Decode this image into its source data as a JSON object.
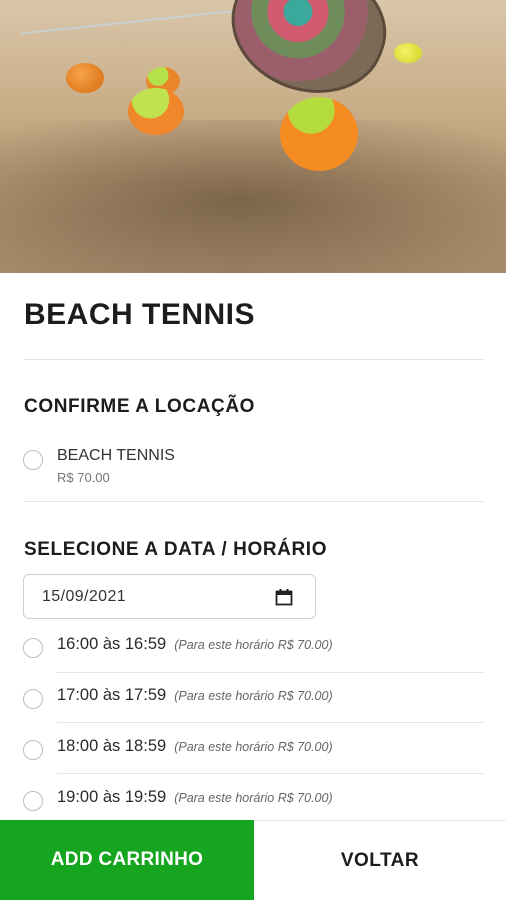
{
  "hero": {
    "image_alt": "beach tennis balls and racket on sand"
  },
  "product": {
    "title": "BEACH TENNIS"
  },
  "location_section": {
    "title": "CONFIRME A LOCAÇÃO",
    "option": {
      "label": "BEACH TENNIS",
      "price": "R$ 70.00"
    }
  },
  "schedule_section": {
    "title": "SELECIONE A DATA / HORÁRIO",
    "date_value": "15/09/2021",
    "slots": [
      {
        "time": "16:00 às 16:59",
        "note": "(Para este horário R$ 70.00)"
      },
      {
        "time": "17:00 às 17:59",
        "note": "(Para este horário R$ 70.00)"
      },
      {
        "time": "18:00 às 18:59",
        "note": "(Para este horário R$ 70.00)"
      },
      {
        "time": "19:00 às 19:59",
        "note": "(Para este horário R$ 70.00)"
      }
    ]
  },
  "actions": {
    "add_label": "ADD CARRINHO",
    "back_label": "VOLTAR"
  },
  "colors": {
    "primary_green": "#16a51f",
    "ball_orange": "#f08a24",
    "ball_green": "#a8d23a"
  }
}
